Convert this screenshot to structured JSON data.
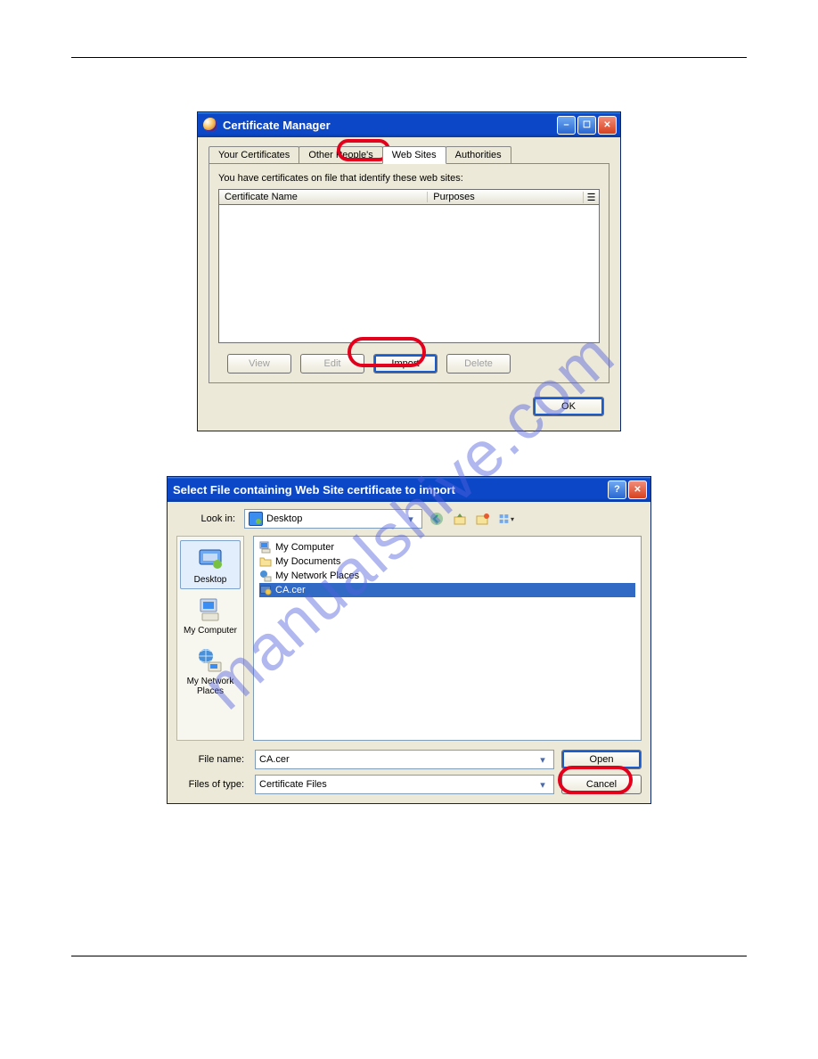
{
  "watermark": "manualshive.com",
  "cert_manager": {
    "title": "Certificate Manager",
    "tabs": [
      "Your Certificates",
      "Other People's",
      "Web Sites",
      "Authorities"
    ],
    "active_tab_index": 2,
    "intro": "You have certificates on file that identify these web sites:",
    "columns": {
      "name": "Certificate Name",
      "purposes": "Purposes"
    },
    "buttons": {
      "view": "View",
      "edit": "Edit",
      "import": "Import",
      "delete": "Delete",
      "ok": "OK"
    }
  },
  "file_dialog": {
    "title": "Select File containing Web Site certificate to import",
    "look_in_label": "Look in:",
    "look_in_value": "Desktop",
    "places": [
      "Desktop",
      "My Computer",
      "My Network Places"
    ],
    "selected_place_index": 0,
    "listing": [
      {
        "icon": "computer-icon",
        "label": "My Computer",
        "selected": false
      },
      {
        "icon": "folder-icon",
        "label": "My Documents",
        "selected": false
      },
      {
        "icon": "network-icon",
        "label": "My Network Places",
        "selected": false
      },
      {
        "icon": "cert-icon",
        "label": "CA.cer",
        "selected": true
      }
    ],
    "filename_label": "File name:",
    "filename_value": "CA.cer",
    "filetype_label": "Files of type:",
    "filetype_value": "Certificate Files",
    "open_label": "Open",
    "cancel_label": "Cancel"
  },
  "toolbar_icons": [
    "back-icon",
    "up-icon",
    "new-folder-icon",
    "view-menu-icon"
  ]
}
